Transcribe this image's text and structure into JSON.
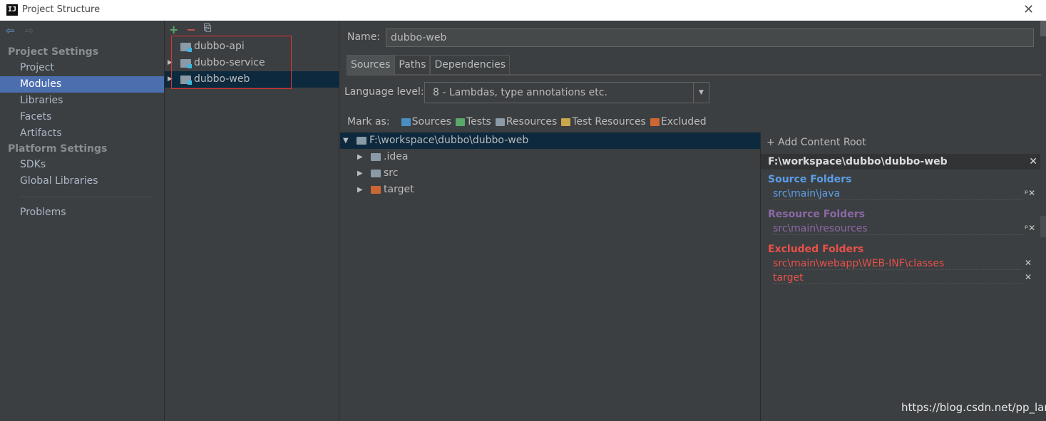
{
  "window": {
    "title": "Project Structure",
    "app_icon": "IJ"
  },
  "sidebar": {
    "project_settings_header": "Project Settings",
    "platform_settings_header": "Platform Settings",
    "items": [
      {
        "label": "Project"
      },
      {
        "label": "Modules",
        "selected": true
      },
      {
        "label": "Libraries"
      },
      {
        "label": "Facets"
      },
      {
        "label": "Artifacts"
      }
    ],
    "platform_items": [
      {
        "label": "SDKs"
      },
      {
        "label": "Global Libraries"
      }
    ],
    "problems_label": "Problems"
  },
  "modules": {
    "toolbar": {
      "add": "+",
      "remove": "−",
      "copy": "⎘"
    },
    "list": [
      {
        "name": "dubbo-api"
      },
      {
        "name": "dubbo-service"
      },
      {
        "name": "dubbo-web",
        "selected": true
      }
    ]
  },
  "detail": {
    "name_label": "Name:",
    "name_value": "dubbo-web",
    "tabs": [
      "Sources",
      "Paths",
      "Dependencies"
    ],
    "language_label": "Language level:",
    "language_value": "8 - Lambdas, type annotations etc.",
    "mark_as_label": "Mark as:",
    "mark_as": [
      {
        "label": "Sources",
        "color": "#4a8fc4"
      },
      {
        "label": "Tests",
        "color": "#59a869"
      },
      {
        "label": "Resources",
        "color": "#8a9aa6"
      },
      {
        "label": "Test Resources",
        "color": "#c9a84c"
      },
      {
        "label": "Excluded",
        "color": "#cc6633"
      }
    ],
    "tree": {
      "root": "F:\\workspace\\dubbo\\dubbo-web",
      "children": [
        {
          "label": ".idea",
          "color": "#8a9aa6"
        },
        {
          "label": "src",
          "color": "#8a9aa6"
        },
        {
          "label": "target",
          "color": "#cc6633"
        }
      ]
    }
  },
  "content_root": {
    "add_label": "+ Add Content Root",
    "path": "F:\\workspace\\dubbo\\dubbo-web",
    "source_header": "Source Folders",
    "source_items": [
      "src\\main\\java"
    ],
    "resource_header": "Resource Folders",
    "resource_items": [
      "src\\main\\resources"
    ],
    "excluded_header": "Excluded Folders",
    "excluded_items": [
      "src\\main\\webapp\\WEB-INF\\classes",
      "target"
    ],
    "colors": {
      "source": "#5c9ee8",
      "resource": "#8b68a6",
      "excluded": "#e8504a"
    }
  },
  "watermark": "https://blog.csdn.net/pp_lan"
}
